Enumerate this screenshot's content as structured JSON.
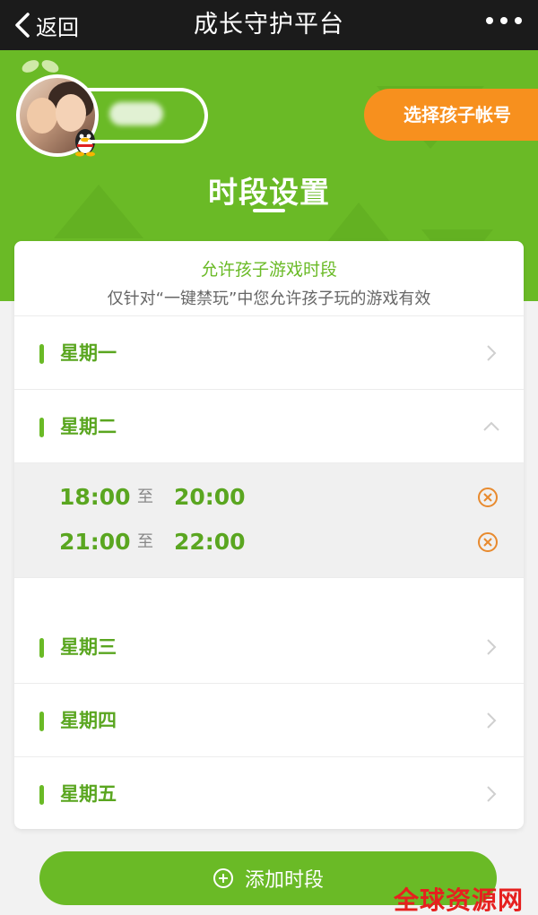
{
  "nav": {
    "back_label": "返回",
    "title": "成长守护平台"
  },
  "header": {
    "select_child_label": "选择孩子帐号",
    "page_title": "时段设置"
  },
  "card": {
    "heading": "允许孩子游戏时段",
    "subheading": "仅针对“一键禁玩”中您允许孩子玩的游戏有效"
  },
  "days": [
    {
      "label": "星期一",
      "expanded": false
    },
    {
      "label": "星期二",
      "expanded": true
    },
    {
      "label": "星期三",
      "expanded": false
    },
    {
      "label": "星期四",
      "expanded": false
    },
    {
      "label": "星期五",
      "expanded": false
    }
  ],
  "slots": [
    {
      "start": "18:00",
      "to": "至",
      "end": "20:00"
    },
    {
      "start": "21:00",
      "to": "至",
      "end": "22:00"
    }
  ],
  "footer": {
    "add_label": "添加时段"
  },
  "watermark": "全球资源网",
  "colors": {
    "green": "#6aba26",
    "orange": "#f7901e",
    "delete": "#e88a2e",
    "nav": "#1b1b1b"
  }
}
